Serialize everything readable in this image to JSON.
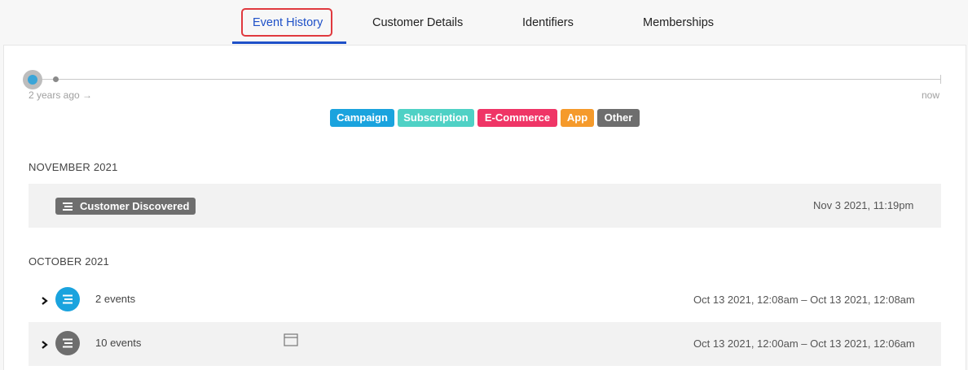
{
  "tabs": [
    {
      "label": "Event History"
    },
    {
      "label": "Customer Details"
    },
    {
      "label": "Identifiers"
    },
    {
      "label": "Memberships"
    }
  ],
  "timeline": {
    "start_label": "2 years ago →",
    "end_label": "now"
  },
  "legend": [
    {
      "label": "Campaign",
      "color": "#1aa3de"
    },
    {
      "label": "Subscription",
      "color": "#4fd1c5"
    },
    {
      "label": "E-Commerce",
      "color": "#ef3566"
    },
    {
      "label": "App",
      "color": "#f59a2b"
    },
    {
      "label": "Other",
      "color": "#6e6e6e"
    }
  ],
  "sections": [
    {
      "title": "NOVEMBER 2021",
      "rows": [
        {
          "badge": "Customer Discovered",
          "date": "Nov 3 2021, 11:19pm"
        }
      ]
    },
    {
      "title": "OCTOBER 2021",
      "rows": [
        {
          "count": "2 events",
          "date": "Oct 13 2021, 12:08am – Oct 13 2021, 12:08am",
          "color": "#1aa3de"
        },
        {
          "count": "10 events",
          "date": "Oct 13 2021, 12:00am – Oct 13 2021, 12:06am",
          "color": "#6e6e6e"
        }
      ]
    }
  ]
}
